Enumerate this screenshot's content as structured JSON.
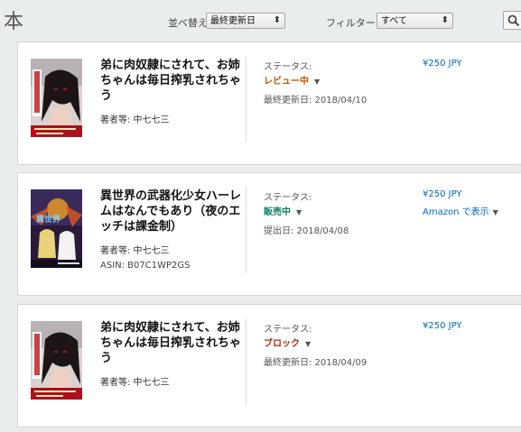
{
  "page": {
    "title": "本"
  },
  "controls": {
    "sort_label": "並べ替え",
    "sort_value": "最終更新日",
    "filter_label": "フィルター:",
    "filter_value": "すべて"
  },
  "colors": {
    "link": "#0066c0",
    "status_review": "#c45500",
    "status_onsale": "#067d62",
    "status_blocked": "#b12704"
  },
  "books": [
    {
      "title": "弟に肉奴隷にされて、お姉ちゃんは毎日搾乳されちゃう",
      "author": "著者等: 中七七三",
      "asin": "",
      "status_label": "ステータス:",
      "status": "レビュー中",
      "date_line": "最終更新日: 2018/04/10",
      "price": "¥250 JPY",
      "amazon_link": ""
    },
    {
      "title": "異世界の武器化少女ハーレムはなんでもあり（夜のエッチは課金制）",
      "author": "著者等: 中七七三",
      "asin": "ASIN: B07C1WP2GS",
      "status_label": "ステータス:",
      "status": "販売中",
      "date_line": "提出日: 2018/04/08",
      "price": "¥250 JPY",
      "amazon_link": "Amazon で表示"
    },
    {
      "title": "弟に肉奴隷にされて、お姉ちゃんは毎日搾乳されちゃう",
      "author": "著者等: 中七七三",
      "asin": "",
      "status_label": "ステータス:",
      "status": "ブロック",
      "date_line": "最終更新日: 2018/04/09",
      "price": "¥250 JPY",
      "amazon_link": ""
    }
  ]
}
